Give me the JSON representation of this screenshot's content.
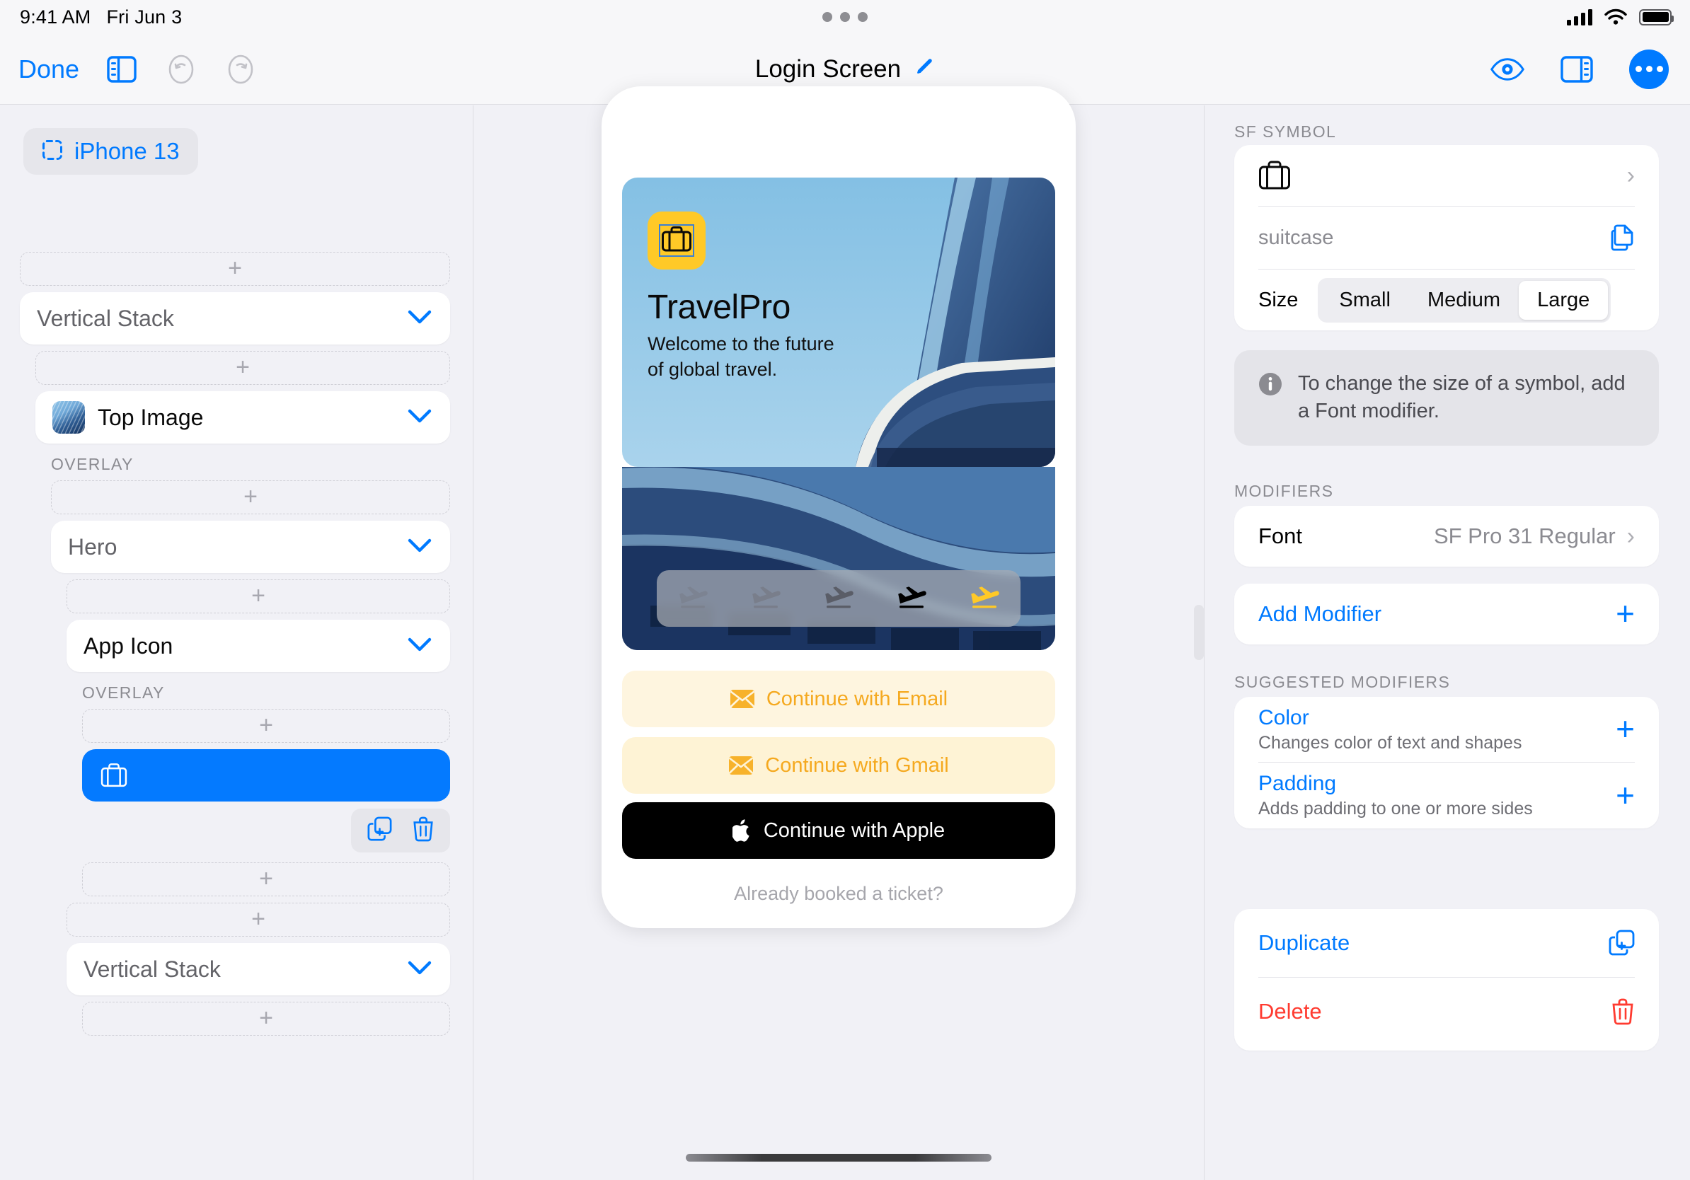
{
  "statusbar": {
    "time": "9:41 AM",
    "date": "Fri Jun 3"
  },
  "toolbar": {
    "done_label": "Done",
    "title": "Login Screen",
    "sidebar_toggle_icon": "sidebar-left-icon",
    "undo_icon": "undo-icon",
    "redo_icon": "redo-icon",
    "edit_title_icon": "pencil-icon",
    "preview_icon": "eye-icon",
    "inspector_toggle_icon": "sidebar-right-icon",
    "more_icon": "ellipsis-icon"
  },
  "left_sidebar": {
    "device_chip": {
      "label": "iPhone 13",
      "icon": "artboard-icon"
    },
    "add_label": "+",
    "tree": [
      {
        "kind": "add",
        "indent": 0
      },
      {
        "kind": "node",
        "indent": 0,
        "label": "Vertical Stack",
        "style": "gray",
        "chevron": "chevron-down-icon"
      },
      {
        "kind": "add",
        "indent": 1
      },
      {
        "kind": "node",
        "indent": 1,
        "label": "Top Image",
        "style": "black",
        "thumb": true,
        "chevron": "chevron-down-icon"
      },
      {
        "kind": "section",
        "indent": 2,
        "label": "OVERLAY"
      },
      {
        "kind": "add",
        "indent": 2
      },
      {
        "kind": "node",
        "indent": 2,
        "label": "Hero",
        "style": "gray",
        "chevron": "chevron-down-icon"
      },
      {
        "kind": "add",
        "indent": 3
      },
      {
        "kind": "node",
        "indent": 3,
        "label": "App Icon",
        "style": "black",
        "chevron": "chevron-down-icon"
      },
      {
        "kind": "section",
        "indent": 4,
        "label": "OVERLAY"
      },
      {
        "kind": "add",
        "indent": 4
      },
      {
        "kind": "selected",
        "indent": 4,
        "icon": "suitcase-icon"
      },
      {
        "kind": "actions",
        "indent": 4,
        "duplicate_icon": "duplicate-icon",
        "delete_icon": "trash-icon"
      },
      {
        "kind": "add",
        "indent": 4
      },
      {
        "kind": "add",
        "indent": 3
      },
      {
        "kind": "node",
        "indent": 3,
        "label": "Vertical Stack",
        "style": "gray",
        "chevron": "chevron-down-icon"
      },
      {
        "kind": "add",
        "indent": 4
      }
    ]
  },
  "preview": {
    "app_icon_symbol": "suitcase-icon",
    "title": "TravelPro",
    "subtitle": "Welcome to the future\nof global travel.",
    "flight_icons": [
      {
        "name": "airplane-arrival-icon",
        "opacity": 0.28,
        "color": "#6E6E74"
      },
      {
        "name": "airplane-arrival-icon",
        "opacity": 0.45,
        "color": "#6E6E74"
      },
      {
        "name": "airplane-arrival-icon",
        "opacity": 0.7,
        "color": "#4A4A50"
      },
      {
        "name": "airplane-arrival-icon",
        "opacity": 1,
        "color": "#000000"
      },
      {
        "name": "airplane-arrival-icon",
        "opacity": 1,
        "color": "#FFC927"
      }
    ],
    "buttons": [
      {
        "label": "Continue with Email",
        "icon": "envelope-icon",
        "bg": "#FEF5DF",
        "fg": "#F5A91F"
      },
      {
        "label": "Continue with Gmail",
        "icon": "envelope-icon",
        "bg": "#FEF3D5",
        "fg": "#F5A91F"
      },
      {
        "label": "Continue with Apple",
        "icon": "apple-logo-icon",
        "bg": "#000000",
        "fg": "#FFFFFF"
      }
    ],
    "footer_link": "Already booked a ticket?"
  },
  "right_sidebar": {
    "sf_symbol": {
      "section_label": "SF SYMBOL",
      "symbol_icon": "suitcase-icon",
      "picker_chevron": "chevron-right-icon",
      "name_value": "suitcase",
      "copy_icon": "copy-icon",
      "size_label": "Size",
      "size_options": [
        "Small",
        "Medium",
        "Large"
      ],
      "size_selected": "Large"
    },
    "info": {
      "icon": "info-circle-icon",
      "text": "To change the size of a symbol, add a Font modifier."
    },
    "modifiers": {
      "section_label": "MODIFIERS",
      "items": [
        {
          "label": "Font",
          "value": "SF Pro 31 Regular",
          "chevron": "chevron-right-icon"
        }
      ],
      "add_label": "Add Modifier",
      "add_icon": "plus-icon"
    },
    "suggested": {
      "section_label": "SUGGESTED MODIFIERS",
      "items": [
        {
          "label": "Color",
          "desc": "Changes color of text and shapes",
          "icon": "plus-icon"
        },
        {
          "label": "Padding",
          "desc": "Adds padding to one or more sides",
          "icon": "plus-icon"
        }
      ]
    },
    "actions": [
      {
        "label": "Duplicate",
        "icon": "duplicate-icon",
        "tone": "blue"
      },
      {
        "label": "Delete",
        "icon": "trash-icon",
        "tone": "red"
      }
    ]
  },
  "colors": {
    "accent": "#007AFF",
    "destructive": "#FF3B30",
    "brand_yellow": "#FFC927",
    "panel_bg": "#F1F1F6",
    "chrome_bg": "#F7F7F9"
  }
}
